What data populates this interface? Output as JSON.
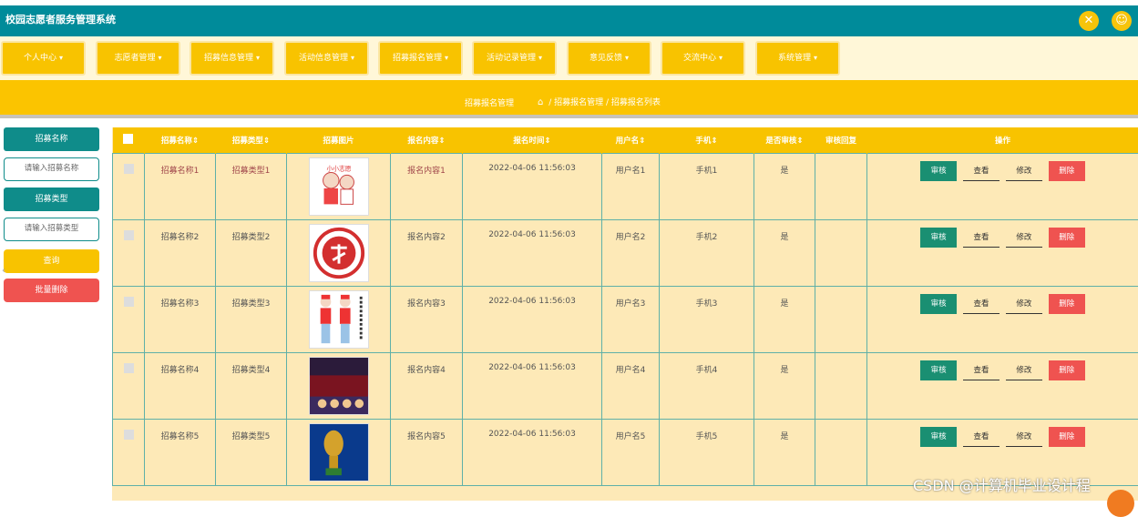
{
  "app": {
    "title": "校园志愿者服务管理系统"
  },
  "nav": [
    {
      "label": "个人中心"
    },
    {
      "label": "志愿者管理"
    },
    {
      "label": "招募信息管理"
    },
    {
      "label": "活动信息管理"
    },
    {
      "label": "招募报名管理"
    },
    {
      "label": "活动记录管理"
    },
    {
      "label": "意见反馈"
    },
    {
      "label": "交流中心"
    },
    {
      "label": "系统管理"
    }
  ],
  "breadcrumb": {
    "title": "招募报名管理",
    "path": "/ 招募报名管理 / 招募报名列表"
  },
  "sidebar": {
    "name_label": "招募名称",
    "name_placeholder": "请输入招募名称",
    "type_label": "招募类型",
    "type_placeholder": "请输入招募类型",
    "query_button": "查询",
    "batch_delete_button": "批量删除"
  },
  "table": {
    "headers": [
      "招募名称",
      "招募类型",
      "招募图片",
      "报名内容",
      "报名时间",
      "用户名",
      "手机",
      "是否审核",
      "审核回复",
      "操作"
    ],
    "rows": [
      {
        "name": "招募名称1",
        "type": "招募类型1",
        "content": "报名内容1",
        "time": "2022-04-06 11:56:03",
        "user": "用户名1",
        "phone": "手机1",
        "audited": "是",
        "reply": "",
        "image": "volunteer-cartoon"
      },
      {
        "name": "招募名称2",
        "type": "招募类型2",
        "content": "报名内容2",
        "time": "2022-04-06 11:56:03",
        "user": "用户名2",
        "phone": "手机2",
        "audited": "是",
        "reply": "",
        "image": "red-volunteer-logo"
      },
      {
        "name": "招募名称3",
        "type": "招募类型3",
        "content": "报名内容3",
        "time": "2022-04-06 11:56:03",
        "user": "用户名3",
        "phone": "手机3",
        "audited": "是",
        "reply": "",
        "image": "volunteer-figures"
      },
      {
        "name": "招募名称4",
        "type": "招募类型4",
        "content": "报名内容4",
        "time": "2022-04-06 11:56:03",
        "user": "用户名4",
        "phone": "手机4",
        "audited": "是",
        "reply": "",
        "image": "world-cup-poster"
      },
      {
        "name": "招募名称5",
        "type": "招募类型5",
        "content": "报名内容5",
        "time": "2022-04-06 11:56:03",
        "user": "用户名5",
        "phone": "手机5",
        "audited": "是",
        "reply": "",
        "image": "fifa-trophy"
      }
    ],
    "actions": {
      "audit": "审核",
      "view": "查看",
      "edit": "修改",
      "delete": "删除"
    }
  },
  "watermark": "CSDN @计算机毕业设计程",
  "colors": {
    "header": "#008b9a",
    "accent": "#f8c300",
    "sidebar": "#0f8c8a",
    "danger": "#ef5350",
    "row_bg": "#fde9b7"
  }
}
